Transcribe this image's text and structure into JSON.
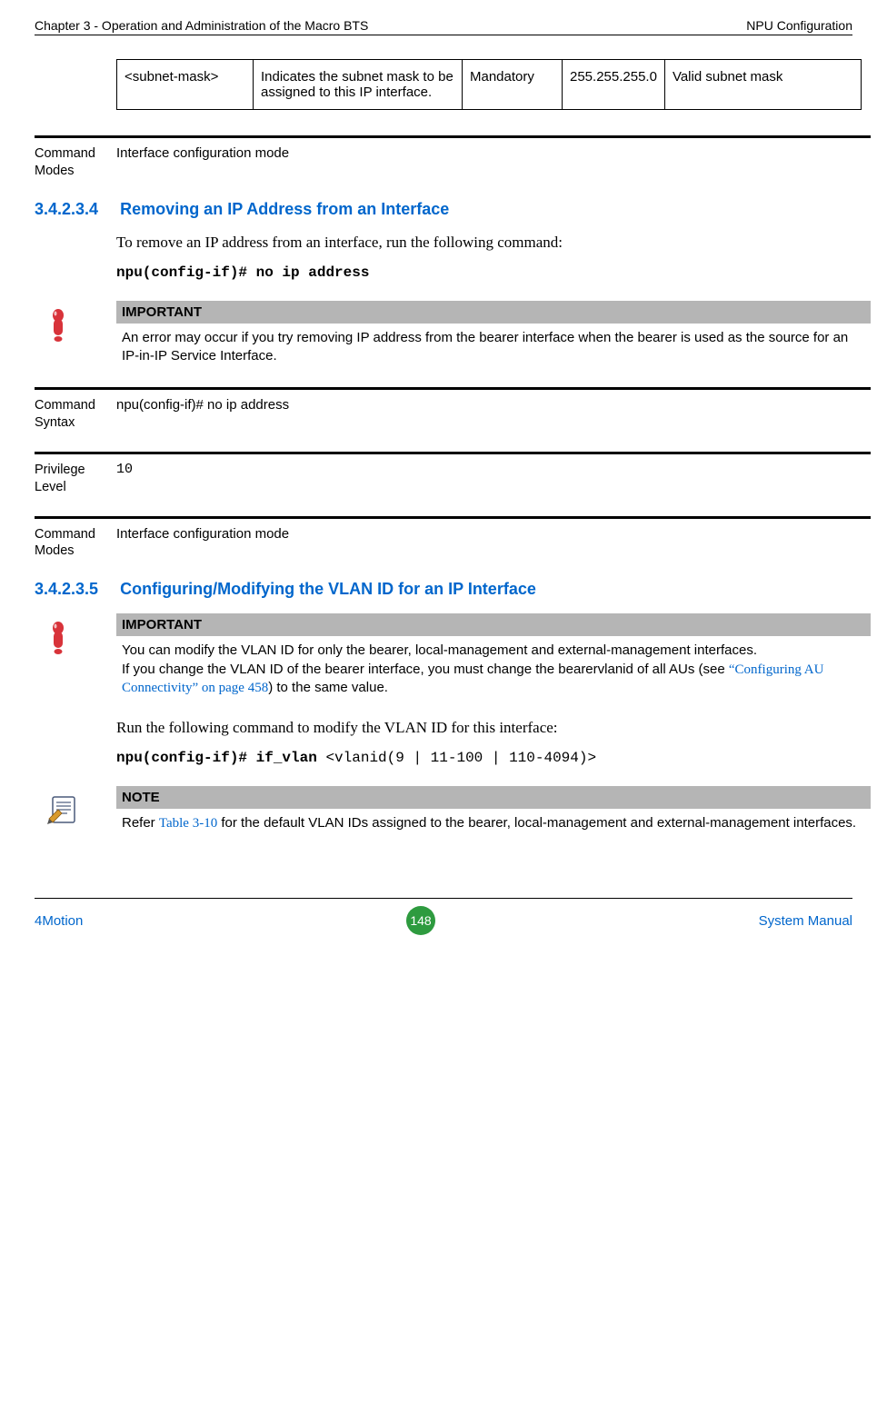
{
  "header": {
    "left": "Chapter 3 - Operation and Administration of the Macro BTS",
    "right": "NPU Configuration"
  },
  "param_table": {
    "c0": "<subnet-mask>",
    "c1": "Indicates the subnet mask to be assigned to this IP interface.",
    "c2": "Mandatory",
    "c3": "255.255.255.0",
    "c4": "Valid subnet mask"
  },
  "defs": {
    "cmd_modes_label": "Command Modes",
    "cmd_modes_val": "Interface configuration mode",
    "cmd_syntax_label": "Command Syntax",
    "cmd_syntax_val": "npu(config-if)# no ip address",
    "priv_level_label": "Privilege Level",
    "priv_level_val": "10",
    "cmd_modes2_val": "Interface configuration mode"
  },
  "sec1": {
    "num": "3.4.2.3.4",
    "title": "Removing an IP Address from an Interface",
    "body": "To remove an IP address from an interface, run the following command:",
    "cmd": "npu(config-if)# no ip address"
  },
  "important1": {
    "title": "IMPORTANT",
    "text": "An error may occur if you try removing IP address from the bearer interface when the bearer is used as the source for an IP-in-IP Service Interface."
  },
  "sec2": {
    "num": "3.4.2.3.5",
    "title": "Configuring/Modifying the VLAN ID for an IP Interface"
  },
  "important2": {
    "title": "IMPORTANT",
    "text1": "You can modify the VLAN ID for only the bearer, local-management and external-management interfaces.",
    "text2a": "If you change the VLAN ID of the bearer interface, you must change the bearervlanid of all AUs (see ",
    "link": "“Configuring AU Connectivity” on page 458",
    "text2b": ") to the same value."
  },
  "body2": "Run the following command to modify the VLAN ID for this interface:",
  "cmd2": {
    "bold": "npu(config-if)# if_vlan ",
    "plain": "<vlanid(9 | 11-100 | 110-4094)>"
  },
  "note": {
    "title": "NOTE",
    "pre": "Refer ",
    "link": "Table 3-10",
    "post": " for the default VLAN IDs assigned to the bearer, local-management and external-management interfaces."
  },
  "footer": {
    "left": "4Motion",
    "page": "148",
    "right": "System Manual"
  }
}
